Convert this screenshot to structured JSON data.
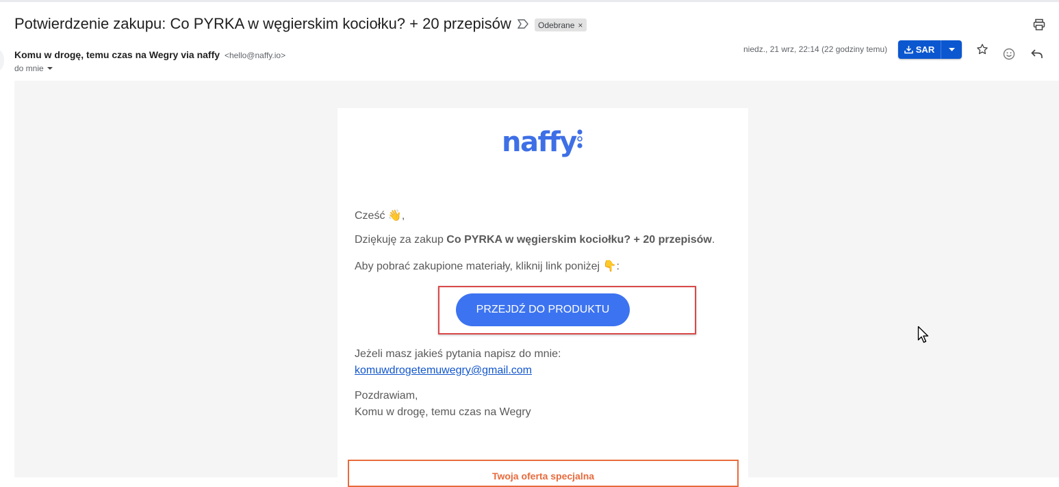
{
  "email": {
    "subject": "Potwierdzenie zakupu: Co PYRKA w węgierskim kociołku? + 20 przepisów",
    "label": "Odebrane",
    "label_remove": "×",
    "sender_name": "Komu w drogę, temu czas na Wegry via naffy",
    "sender_email": "<hello@naffy.io>",
    "recipient": "do mnie",
    "date": "niedz., 21 wrz, 22:14 (22 godziny temu)",
    "save_button": "SAR"
  },
  "body": {
    "logo": "naffy",
    "greeting": "Cześć",
    "greeting_emoji": "👋",
    "greeting_end": ",",
    "thanks_prefix": "Dziękuję za zakup ",
    "product_name": "Co PYRKA w węgierskim kociołku? + 20 przepisów",
    "thanks_suffix": ".",
    "download_text": "Aby pobrać zakupione materiały, kliknij link poniżej ",
    "download_emoji": "👇",
    "download_end": ":",
    "cta_button": "PRZEJDŹ DO PRODUKTU",
    "questions_text": "Jeżeli masz jakieś pytania napisz do mnie:",
    "contact_email": "komuwdrogetemuwegry@gmail.com",
    "closing": "Pozdrawiam,",
    "signature": "Komu w drogę, temu czas na Wegry",
    "offer_title": "Twoja oferta specjalna"
  },
  "colors": {
    "accent": "#0b57d0",
    "cta": "#3c73f0",
    "logo": "#3e6fe6",
    "highlight_border": "#d94848",
    "offer": "#e86a3c",
    "link": "#1155cc"
  },
  "icons": [
    "important-marker-icon",
    "print-icon",
    "download-icon",
    "dropdown-arrow-icon",
    "star-icon",
    "emoji-icon",
    "reply-icon",
    "chevron-down-icon",
    "mouse-cursor-icon"
  ]
}
